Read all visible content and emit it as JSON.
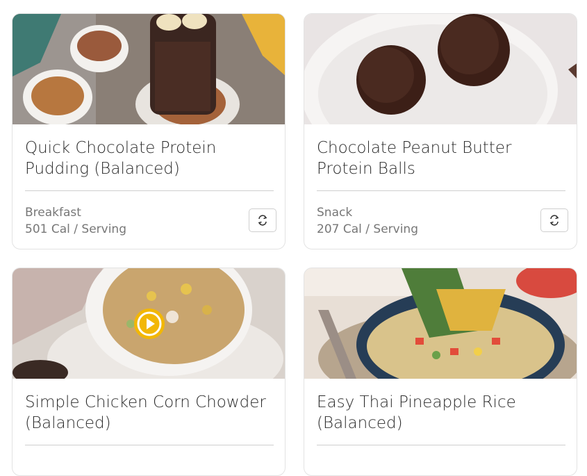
{
  "recipes": [
    {
      "title": "Quick Chocolate Protein Pudding (Balanced)",
      "meal": "Breakfast",
      "calories": "501 Cal / Serving",
      "swap_icon": "swap-icon"
    },
    {
      "title": "Chocolate Peanut Butter Protein Balls",
      "meal": "Snack",
      "calories": "207 Cal / Serving",
      "swap_icon": "swap-icon"
    },
    {
      "title": "Simple Chicken Corn Chowder (Balanced)",
      "has_video": true,
      "video_icon": "play-icon"
    },
    {
      "title": "Easy Thai Pineapple Rice (Balanced)"
    }
  ],
  "colors": {
    "play_accent": "#f2b705",
    "border": "#e3e3e3"
  }
}
